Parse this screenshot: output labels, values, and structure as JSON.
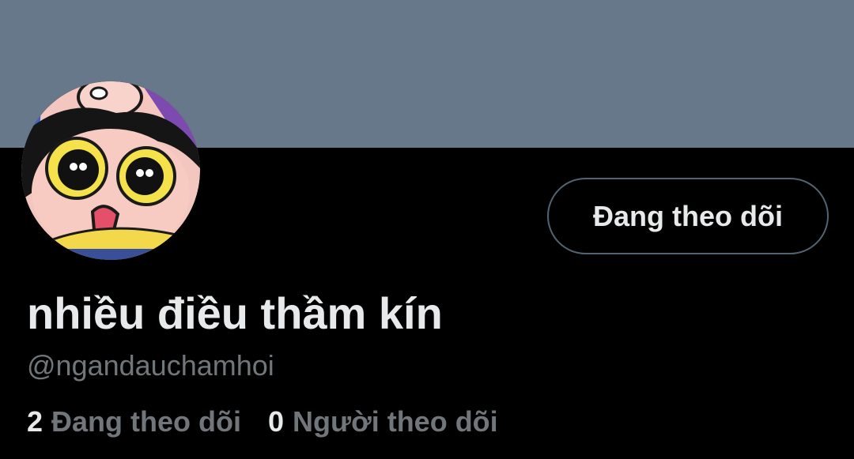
{
  "profile": {
    "banner_color": "#66788a",
    "avatar_icon": "cartoon-girl-avatar",
    "follow_button_label": "Đang theo dõi",
    "display_name": "nhiều điều thầm kín",
    "handle": "@ngandauchamhoi",
    "following_count": "2",
    "following_label": "Đang theo dõi",
    "followers_count": "0",
    "followers_label": "Người theo dõi"
  },
  "colors": {
    "background": "#000000",
    "primary_text": "#e7e9ea",
    "secondary_text": "#71767b",
    "button_border": "#536471"
  }
}
